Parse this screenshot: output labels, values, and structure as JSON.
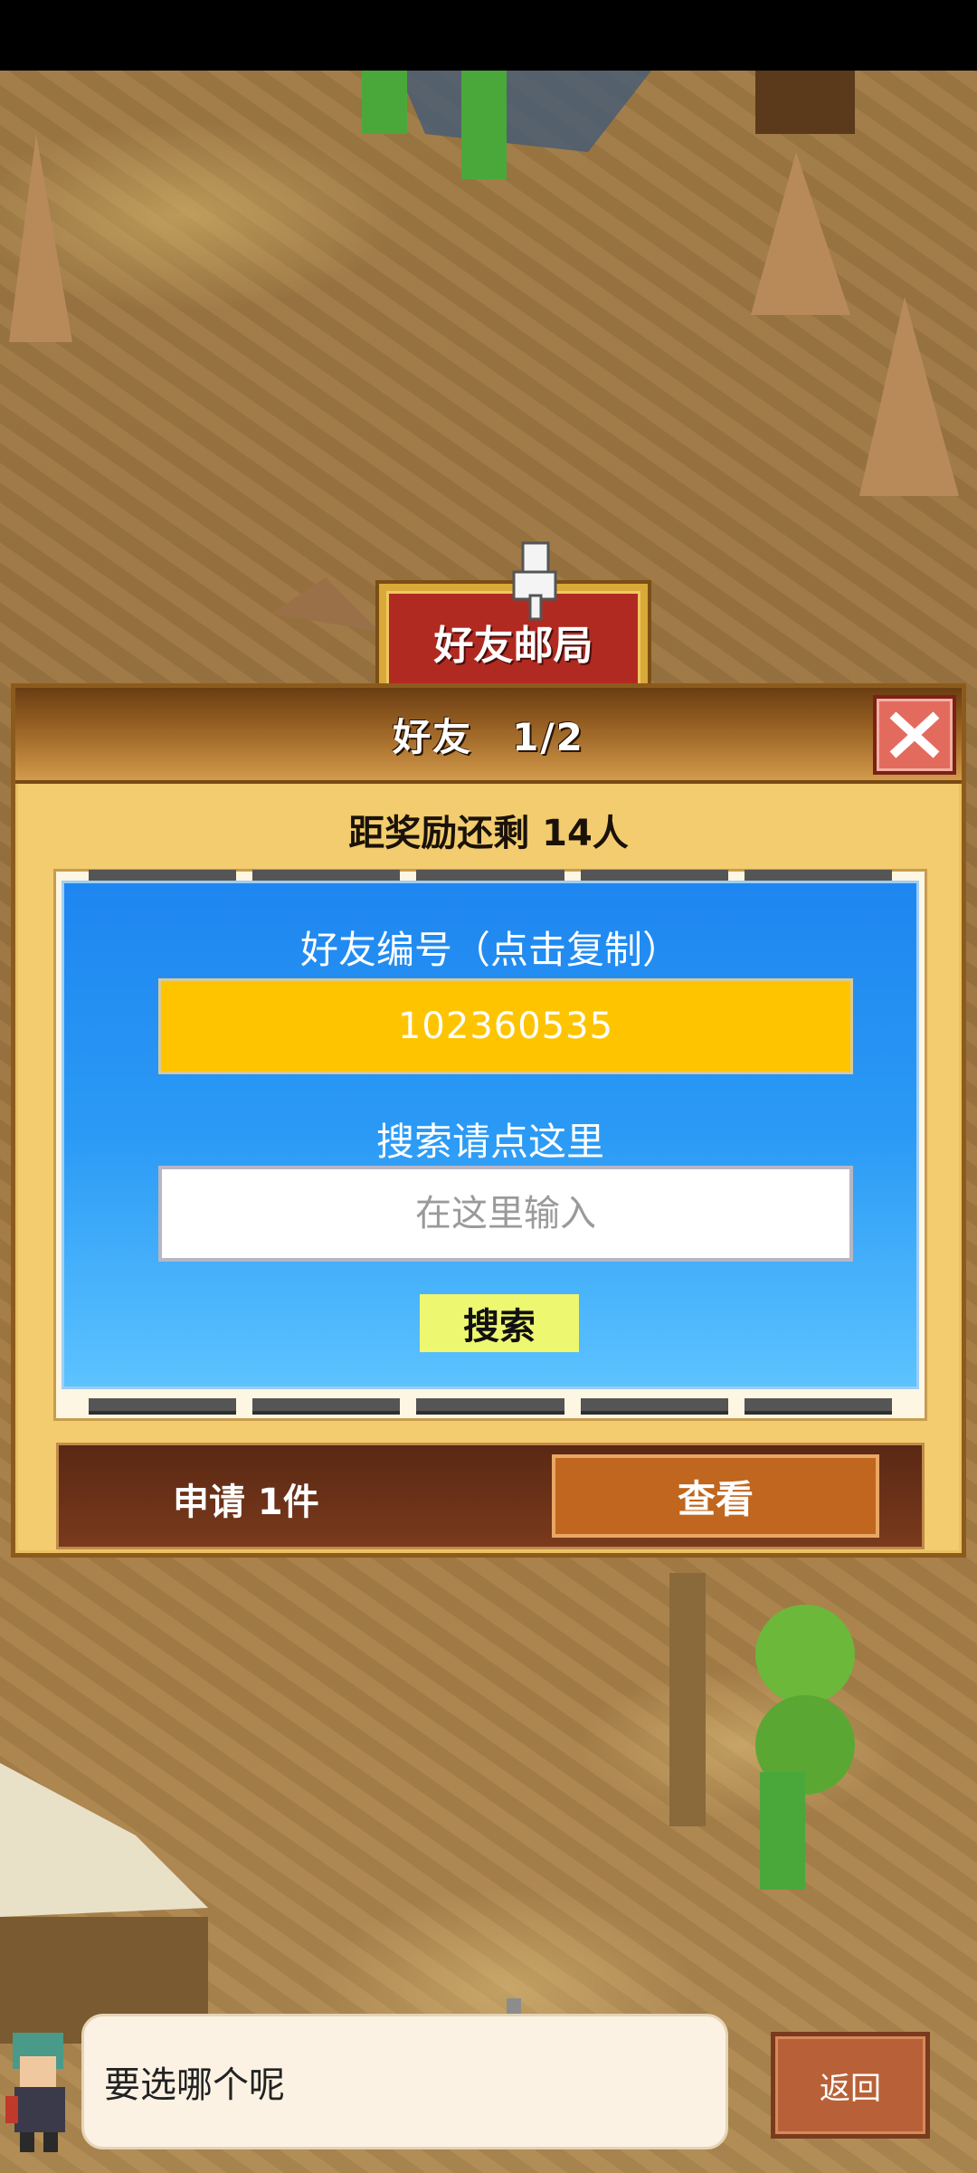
{
  "map": {
    "sign_label": "好友邮局"
  },
  "dialog": {
    "title": "好友　1/2",
    "reward_text": "距奖励还剩 14人",
    "code_label": "好友编号（点击复制）",
    "friend_code": "102360535",
    "search_label": "搜索请点这里",
    "search_placeholder": "在这里输入",
    "search_button": "搜索",
    "request_text": "申请 1件",
    "view_button": "查看"
  },
  "bottom": {
    "speech": "要选哪个呢",
    "back_button": "返回"
  },
  "icons": {
    "close": "close-icon",
    "pointer": "pointing-hand-icon",
    "left_arrow": "arrow-left-icon",
    "right_arrow": "arrow-right-icon"
  },
  "colors": {
    "panel_blue": "#2b9af5",
    "code_yellow": "#ffc400",
    "close_red": "#e36b5e",
    "sign_red": "#b02a22",
    "view_orange": "#c0661e"
  }
}
